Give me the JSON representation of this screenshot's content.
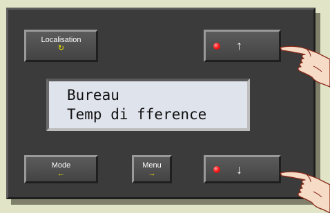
{
  "buttons": {
    "localisation": {
      "label": "Localisation",
      "glyph": "↻"
    },
    "mode": {
      "label": "Mode",
      "glyph": "←"
    },
    "menu": {
      "label": "Menu",
      "glyph": "→"
    },
    "up": {
      "glyph": "↑"
    },
    "down": {
      "glyph": "↓"
    }
  },
  "display": {
    "line1": "Bureau",
    "line2": "Temp di fference"
  },
  "icons": [
    "refresh-icon",
    "arrow-left-icon",
    "arrow-right-icon",
    "arrow-up-icon",
    "arrow-down-icon",
    "pointing-hand-icon"
  ],
  "colors": {
    "background": "#e2e4c7",
    "panel": "#3b3b3b",
    "accent": "#f2e600",
    "led": "#ff2020",
    "lcd": "#dfe3ec"
  }
}
